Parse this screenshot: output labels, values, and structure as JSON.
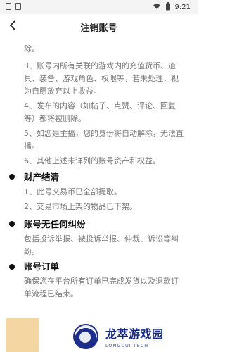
{
  "status_bar": {
    "time": "9:21"
  },
  "header": {
    "title": "注销账号"
  },
  "content": {
    "lines": [
      "除。",
      "3、账号内所有关联的游戏内的充值货币、道",
      "具、装备、游戏角色、权限等，若未处理，视",
      "为自愿放弃以上收益。",
      "4、发布的内容（如帖子、点赞、评论、回复",
      "等）都将被删除。",
      "5、如您是主播，您的身份将自动解除，无法直",
      "播。",
      "6、其他上述未详列的账号资产和权益。"
    ],
    "sections": [
      {
        "title": "财产结清",
        "lines": [
          "1、此号交易币已全部提取。",
          "2、交易市场上架的物品已下架。"
        ]
      },
      {
        "title": "账号无任何纠纷",
        "lines": [
          "包括投诉举报、被投诉举报、仲裁、诉讼等纠",
          "纷。"
        ]
      },
      {
        "title": "账号订单",
        "lines": [
          "确保您在平台所有订单已完成发货以及退款订",
          "单流程已结束。"
        ]
      }
    ]
  },
  "watermark": {
    "title": "龙萃游戏园",
    "subtitle": "LONGCUI TECH"
  },
  "icons": {
    "back": "chevron-left-icon",
    "wifi": "wifi-icon",
    "battery": "battery-icon"
  },
  "colors": {
    "background": "#ffffff",
    "status_bar": "#f4f4f4",
    "body_text": "#777777",
    "heading_text": "#111111",
    "watermark_blue": "#152a86",
    "button_tan": "#f4d6a3"
  }
}
